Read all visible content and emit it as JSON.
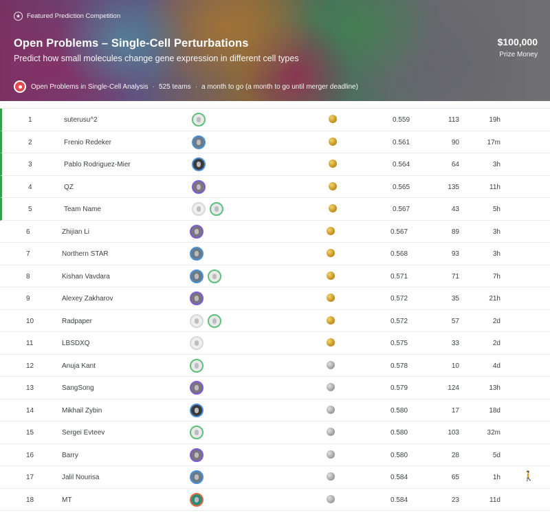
{
  "header": {
    "featured": "Featured Prediction Competition",
    "title": "Open Problems – Single-Cell Perturbations",
    "subtitle": "Predict how small molecules change gene expression in different cell types",
    "prize_amount": "$100,000",
    "prize_label": "Prize Money",
    "host": "Open Problems in Single-Cell Analysis",
    "teams": "525 teams",
    "deadline": "a month to go (a month to go until merger deadline)"
  },
  "leaderboard": {
    "rows": [
      {
        "rank": "1",
        "name": "suterusu^2",
        "score": "0.559",
        "entries": "113",
        "last": "19h",
        "medal": "gold",
        "avatars": [
          "green"
        ],
        "medal_zone": true
      },
      {
        "rank": "2",
        "name": "Frenio Redeker",
        "score": "0.561",
        "entries": "90",
        "last": "17m",
        "medal": "gold",
        "avatars": [
          "blue"
        ],
        "medal_zone": true
      },
      {
        "rank": "3",
        "name": "Pablo Rodriguez-Mier",
        "score": "0.564",
        "entries": "64",
        "last": "3h",
        "medal": "gold",
        "avatars": [
          "dark"
        ],
        "medal_zone": true
      },
      {
        "rank": "4",
        "name": "QZ",
        "score": "0.565",
        "entries": "135",
        "last": "11h",
        "medal": "gold",
        "avatars": [
          "purple"
        ],
        "medal_zone": true
      },
      {
        "rank": "5",
        "name": "Team Name",
        "score": "0.567",
        "entries": "43",
        "last": "5h",
        "medal": "gold",
        "avatars": [
          "light",
          "green"
        ],
        "medal_zone": true
      },
      {
        "rank": "6",
        "name": "Zhijian Li",
        "score": "0.567",
        "entries": "89",
        "last": "3h",
        "medal": "gold",
        "avatars": [
          "purple"
        ],
        "medal_zone": false
      },
      {
        "rank": "7",
        "name": "Northern STAR",
        "score": "0.568",
        "entries": "93",
        "last": "3h",
        "medal": "gold",
        "avatars": [
          "blue"
        ],
        "medal_zone": false
      },
      {
        "rank": "8",
        "name": "Kishan Vavdara",
        "score": "0.571",
        "entries": "71",
        "last": "7h",
        "medal": "gold",
        "avatars": [
          "blue",
          "green"
        ],
        "medal_zone": false
      },
      {
        "rank": "9",
        "name": "Alexey Zakharov",
        "score": "0.572",
        "entries": "35",
        "last": "21h",
        "medal": "gold",
        "avatars": [
          "purple"
        ],
        "medal_zone": false
      },
      {
        "rank": "10",
        "name": "Radpaper",
        "score": "0.572",
        "entries": "57",
        "last": "2d",
        "medal": "gold",
        "avatars": [
          "light",
          "green"
        ],
        "medal_zone": false
      },
      {
        "rank": "11",
        "name": "LBSDXQ",
        "score": "0.575",
        "entries": "33",
        "last": "2d",
        "medal": "gold",
        "avatars": [
          "light"
        ],
        "medal_zone": false
      },
      {
        "rank": "12",
        "name": "Anuja Kant",
        "score": "0.578",
        "entries": "10",
        "last": "4d",
        "medal": "silver",
        "avatars": [
          "green"
        ],
        "medal_zone": false
      },
      {
        "rank": "13",
        "name": "SangSong",
        "score": "0.579",
        "entries": "124",
        "last": "13h",
        "medal": "silver",
        "avatars": [
          "purple"
        ],
        "medal_zone": false
      },
      {
        "rank": "14",
        "name": "Mikhail Zybin",
        "score": "0.580",
        "entries": "17",
        "last": "18d",
        "medal": "silver",
        "avatars": [
          "dark"
        ],
        "medal_zone": false
      },
      {
        "rank": "15",
        "name": "Sergei Evteev",
        "score": "0.580",
        "entries": "103",
        "last": "32m",
        "medal": "silver",
        "avatars": [
          "green"
        ],
        "medal_zone": false
      },
      {
        "rank": "16",
        "name": "Barry",
        "score": "0.580",
        "entries": "28",
        "last": "5d",
        "medal": "silver",
        "avatars": [
          "purple"
        ],
        "medal_zone": false
      },
      {
        "rank": "17",
        "name": "Jalil Nourisa",
        "score": "0.584",
        "entries": "65",
        "last": "1h",
        "medal": "silver",
        "avatars": [
          "blue"
        ],
        "medal_zone": false,
        "extra_icon": "person-icon"
      },
      {
        "rank": "18",
        "name": "MT",
        "score": "0.584",
        "entries": "23",
        "last": "11d",
        "medal": "silver",
        "avatars": [
          "teal"
        ],
        "medal_zone": false
      }
    ]
  }
}
